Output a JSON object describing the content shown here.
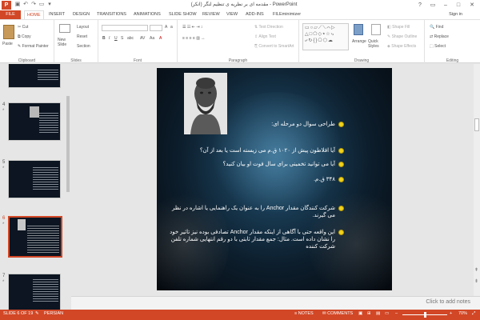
{
  "app": {
    "logo": "P",
    "window_title": "مقدمه ای بر نظریه ی تنظیم لنگر (انکر) - PowerPoint",
    "win_controls": [
      "?",
      "▭",
      "–",
      "□",
      "✕"
    ],
    "sign_in": "Sign in"
  },
  "menu": {
    "file": "FILE",
    "tabs": [
      "HOME",
      "INSERT",
      "DESIGN",
      "TRANSITIONS",
      "ANIMATIONS",
      "SLIDE SHOW",
      "REVIEW",
      "VIEW",
      "ADD-INS",
      "FILEminimizer"
    ]
  },
  "ribbon": {
    "clipboard": {
      "paste": "Paste",
      "cut": "Cut",
      "copy": "Copy",
      "format_painter": "Format Painter",
      "label": "Clipboard"
    },
    "slides": {
      "new_slide": "New Slide",
      "layout": "Layout",
      "reset": "Reset",
      "section": "Section",
      "label": "Slides"
    },
    "font": {
      "label": "Font"
    },
    "paragraph": {
      "text_direction": "Text Direction",
      "align_text": "Align Text",
      "convert_smartart": "Convert to SmartArt",
      "label": "Paragraph"
    },
    "drawing": {
      "arrange": "Arrange",
      "quick_styles": "Quick Styles",
      "shape_fill": "Shape Fill",
      "shape_outline": "Shape Outline",
      "shape_effects": "Shape Effects",
      "label": "Drawing"
    },
    "editing": {
      "find": "Find",
      "replace": "Replace",
      "select": "Select",
      "label": "Editing"
    }
  },
  "thumbnails": [
    {
      "num": "",
      "star": ""
    },
    {
      "num": "4",
      "star": "*"
    },
    {
      "num": "5",
      "star": "*"
    },
    {
      "num": "6",
      "star": "*"
    },
    {
      "num": "7",
      "star": "*"
    }
  ],
  "slide": {
    "lines": [
      "طراحی سوال دو مرحله ای:",
      "آیا افلاطون پیش از ۱۰۲۰ ق.م می زیسته است یا بعد از آن؟",
      "آیا می توانید تخمینی برای سال فوت او بیان کنید؟",
      "۳۴۸ ق.م.",
      "شرکت کنندگان مقدار Anchor را به عنوان یک راهنمایی یا اشاره در نظر می گیرند.",
      "این واقعه حتی با آگاهی از اینکه مقدار Anchor تصادفی بوده نیز تاثیر خود را نشان داده است. مثال: جمع مقدار ثابتی با دو رقم انتهایی شماره تلفن شرکت کننده"
    ]
  },
  "notes": {
    "placeholder": "Click to add notes"
  },
  "status": {
    "slide_info": "SLIDE 6 OF 19",
    "language": "PERSIAN",
    "notes_btn": "NOTES",
    "comments_btn": "COMMENTS",
    "zoom": "70%"
  },
  "colors": {
    "accent": "#d24726",
    "bullet": "#f2d21b"
  }
}
